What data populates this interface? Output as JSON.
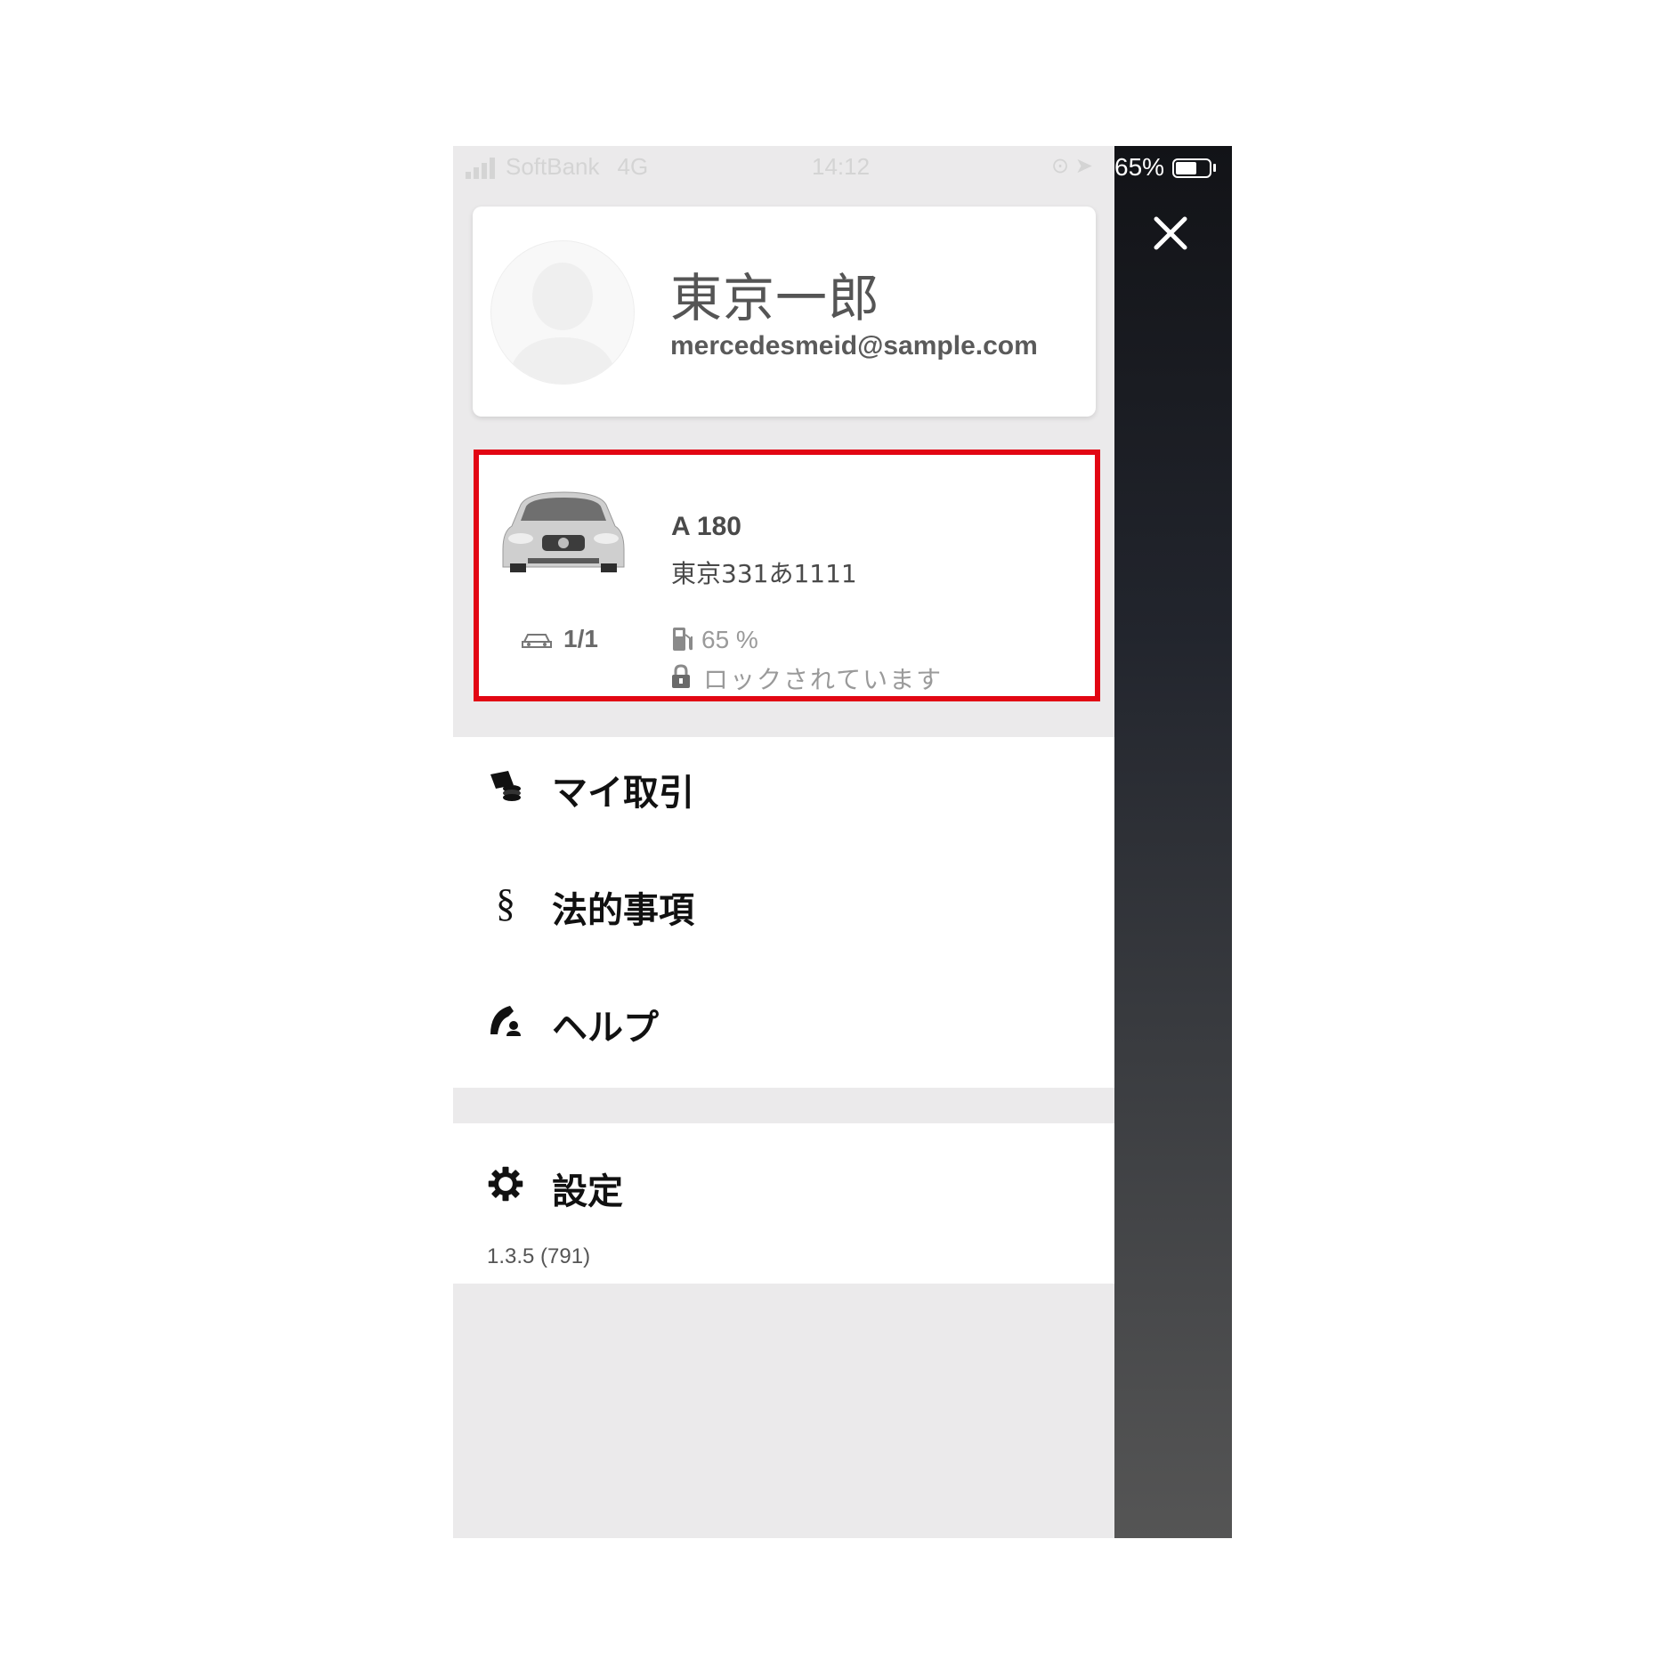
{
  "status_bar": {
    "carrier": "SoftBank",
    "network": "4G",
    "time": "14:12",
    "battery_percent": "65%",
    "battery_level": 0.65
  },
  "profile": {
    "name": "東京一郎",
    "email": "mercedesmeid@sample.com",
    "avatar_icon": "person-silhouette-icon"
  },
  "vehicle": {
    "model": "A 180",
    "plate": "東京331あ1111",
    "count": "1/1",
    "fuel": "65 %",
    "lock_status": "ロックされています",
    "highlight_color": "#e20613"
  },
  "menu": {
    "items": [
      {
        "label": "マイ取引",
        "icon": "transactions-icon"
      },
      {
        "label": "法的事項",
        "icon": "section-sign-icon",
        "glyph": "§"
      },
      {
        "label": "ヘルプ",
        "icon": "help-phone-icon"
      }
    ]
  },
  "settings": {
    "label": "設定",
    "icon": "gear-icon",
    "version": "1.3.5 (791)"
  },
  "close_icon": "close-icon"
}
